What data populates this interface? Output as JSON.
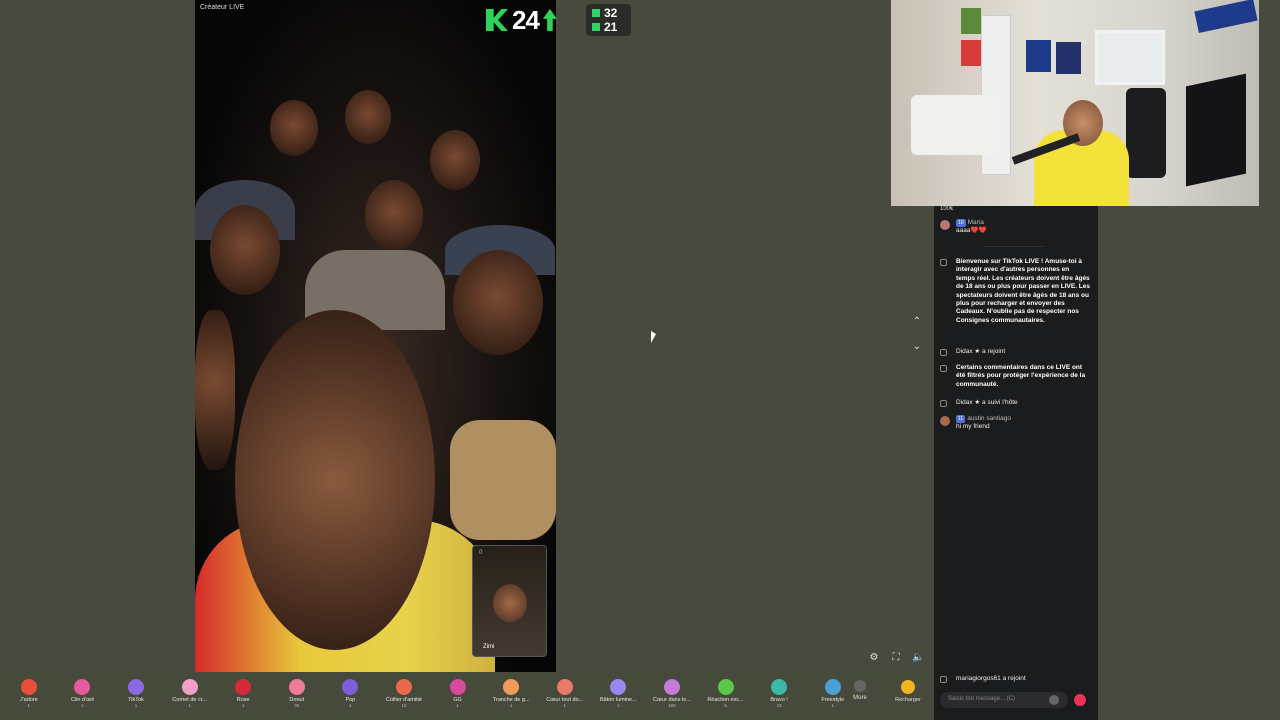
{
  "stream": {
    "creator_label": "Créateur LIVE",
    "score": "24",
    "rank_top": "32",
    "rank_bottom": "21",
    "guest_name": "Zimi",
    "guest_count": "0"
  },
  "chat": {
    "top_text": "100€",
    "messages": [
      {
        "type": "user",
        "badge": "10",
        "name": "Maria",
        "text": "aaaa❤️❤️"
      },
      {
        "type": "system",
        "text": "Bienvenue sur TikTok LIVE ! Amuse-toi à interagir avec d'autres personnes en temps réel. Les créateurs doivent être âgés de 18 ans ou plus pour passer en LIVE. Les spectateurs doivent être âgés de 18 ans ou plus pour recharger et envoyer des Cadeaux. N'oublie pas de respecter nos Consignes communautaires."
      },
      {
        "type": "join",
        "text": "Didax ★ a rejoint"
      },
      {
        "type": "system",
        "text": "Certains commentaires dans ce LIVE ont été filtrés pour protéger l'expérience de la communauté."
      },
      {
        "type": "follow",
        "text": "Didax ★ a suivi l'hôte"
      },
      {
        "type": "user",
        "badge": "11",
        "name": "austin santiago",
        "text": "hi my friend"
      }
    ],
    "bottom_join": "mariagiorgos61 a rejoint",
    "input_placeholder": "Saisis ton message... (C)"
  },
  "gifts": [
    {
      "name": "J'adore",
      "price": "1",
      "color": "#e8503c"
    },
    {
      "name": "Clin d'œil",
      "price": "1",
      "color": "#e85aa0"
    },
    {
      "name": "TikTok",
      "price": "1",
      "color": "#8a6ae0"
    },
    {
      "name": "Cornet de cr...",
      "price": "1",
      "color": "#f3a0c8"
    },
    {
      "name": "Rose",
      "price": "1",
      "color": "#d62a3a"
    },
    {
      "name": "Donut",
      "price": "30",
      "color": "#f07c9a"
    },
    {
      "name": "Pop",
      "price": "1",
      "color": "#7b5fd8"
    },
    {
      "name": "Collier d'amitié",
      "price": "10",
      "color": "#e86a4a"
    },
    {
      "name": "GG",
      "price": "1",
      "color": "#d84a9a"
    },
    {
      "name": "Tranche de g...",
      "price": "1",
      "color": "#f29a5a"
    },
    {
      "name": "Cœur tout do...",
      "price": "1",
      "color": "#e87a6a"
    },
    {
      "name": "Bâton lumine...",
      "price": "1",
      "color": "#9a88f0"
    },
    {
      "name": "Cœur dans le...",
      "price": "100",
      "color": "#c87ad8"
    },
    {
      "name": "Réaction exc...",
      "price": "5",
      "color": "#5ac84a"
    },
    {
      "name": "Bravo !",
      "price": "15",
      "color": "#3ab8a8"
    },
    {
      "name": "Freestyle",
      "price": "1",
      "color": "#4aa0d8"
    }
  ],
  "more_label": "More",
  "recharge_label": "Recharger"
}
